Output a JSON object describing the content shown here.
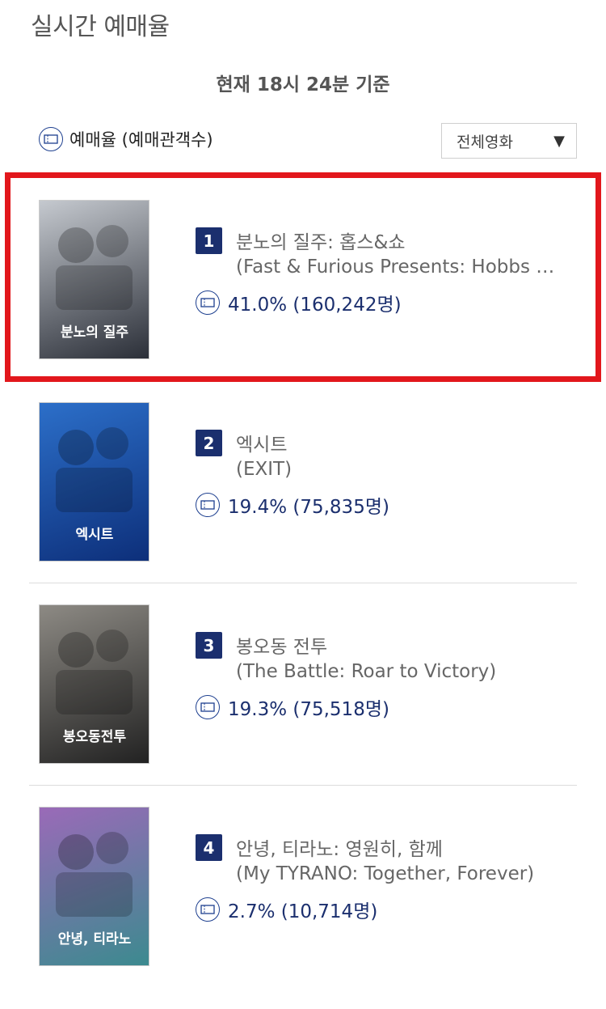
{
  "header": {
    "title": "실시간 예매율",
    "time_prefix": "현재",
    "time": "18시 24분",
    "time_suffix": "기준"
  },
  "legend": {
    "icon": "ticket-icon",
    "label": "예매율 (예매관객수)"
  },
  "filter": {
    "selected": "전체영화",
    "arrow": "▼"
  },
  "movies": [
    {
      "rank": "1",
      "title": "분노의 질주: 홉스&쇼",
      "subtitle": "(Fast & Furious Presents: Hobbs & Shaw)",
      "rate": "41.0% (160,242명)",
      "poster_colors": [
        "#c5c9cf",
        "#2b2f38"
      ],
      "poster_text": "분노의 질주",
      "highlighted": true
    },
    {
      "rank": "2",
      "title": "엑시트",
      "subtitle": "(EXIT)",
      "rate": "19.4% (75,835명)",
      "poster_colors": [
        "#2c6fc9",
        "#0d2f7a"
      ],
      "poster_text": "엑시트"
    },
    {
      "rank": "3",
      "title": "봉오동 전투",
      "subtitle": "(The Battle: Roar to Victory)",
      "rate": "19.3% (75,518명)",
      "poster_colors": [
        "#8d8a84",
        "#222"
      ],
      "poster_text": "봉오동전투"
    },
    {
      "rank": "4",
      "title": "안녕, 티라노: 영원히, 함께",
      "subtitle": "(My TYRANO: Together, Forever)",
      "rate": "2.7% (10,714명)",
      "poster_colors": [
        "#9a6ab8",
        "#3c8a8f"
      ],
      "poster_text": "안녕, 티라노"
    }
  ],
  "colors": {
    "accent": "#1b2f6e",
    "highlight_border": "#e2171c"
  }
}
